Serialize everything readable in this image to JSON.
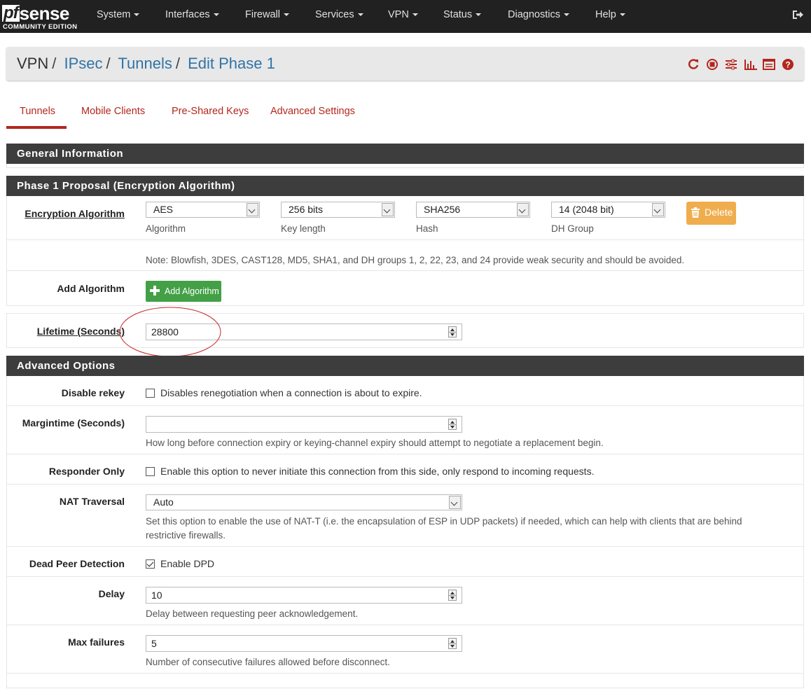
{
  "navbar": {
    "logo_pf": "pf",
    "logo_sense": "sense",
    "logo_sub": "COMMUNITY EDITION",
    "menu": [
      "System",
      "Interfaces",
      "Firewall",
      "Services",
      "VPN",
      "Status",
      "Diagnostics",
      "Help"
    ]
  },
  "breadcrumb": {
    "root": "VPN",
    "sep": "/",
    "items": [
      "IPsec",
      "Tunnels",
      "Edit Phase 1"
    ]
  },
  "tabs": [
    "Tunnels",
    "Mobile Clients",
    "Pre-Shared Keys",
    "Advanced Settings"
  ],
  "sections": {
    "general": "General Information",
    "phase1": "Phase 1 Proposal (Encryption Algorithm)",
    "advanced": "Advanced Options"
  },
  "encryption": {
    "label": "Encryption Algorithm",
    "algorithm": {
      "value": "AES",
      "help": "Algorithm"
    },
    "key_length": {
      "value": "256 bits",
      "help": "Key length"
    },
    "hash": {
      "value": "SHA256",
      "help": "Hash"
    },
    "dh_group": {
      "value": "14 (2048 bit)",
      "help": "DH Group"
    },
    "delete_label": "Delete",
    "note": "Note: Blowfish, 3DES, CAST128, MD5, SHA1, and DH groups 1, 2, 22, 23, and 24 provide weak security and should be avoided."
  },
  "add_algorithm": {
    "label": "Add Algorithm",
    "button": "Add Algorithm"
  },
  "lifetime": {
    "label": "Lifetime (Seconds)",
    "value": "28800"
  },
  "advanced": {
    "disable_rekey": {
      "label": "Disable rekey",
      "text": "Disables renegotiation when a connection is about to expire.",
      "checked": false
    },
    "margintime": {
      "label": "Margintime (Seconds)",
      "value": "",
      "help": "How long before connection expiry or keying-channel expiry should attempt to negotiate a replacement begin."
    },
    "responder_only": {
      "label": "Responder Only",
      "text": "Enable this option to never initiate this connection from this side, only respond to incoming requests.",
      "checked": false
    },
    "nat_traversal": {
      "label": "NAT Traversal",
      "value": "Auto",
      "help_line1": "Set this option to enable the use of NAT-T (i.e. the encapsulation of ESP in UDP packets) if needed, which can help with clients that are behind",
      "help_line2": "restrictive firewalls."
    },
    "dpd": {
      "label": "Dead Peer Detection",
      "text": "Enable DPD",
      "checked": true
    },
    "delay": {
      "label": "Delay",
      "value": "10",
      "help": "Delay between requesting peer acknowledgement."
    },
    "max_failures": {
      "label": "Max failures",
      "value": "5",
      "help": "Number of consecutive failures allowed before disconnect."
    }
  },
  "colors": {
    "navbar": "#212121",
    "panel_header": "#3d3d3d",
    "link": "#3173a6",
    "tab_red": "#b3271e",
    "delete_orange": "#f0ad4e",
    "add_green": "#43a047",
    "icon_red": "#b3271e"
  }
}
